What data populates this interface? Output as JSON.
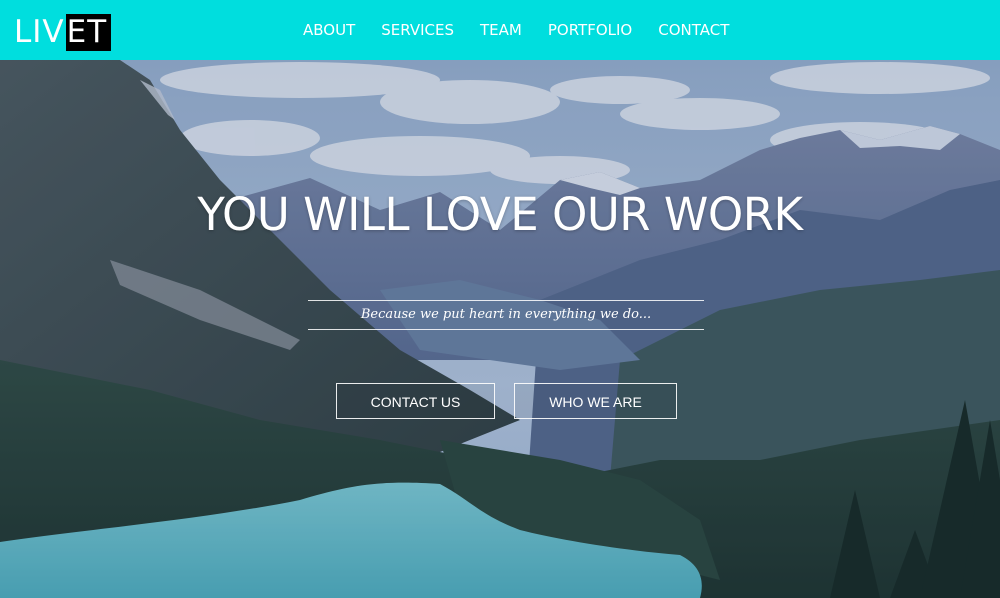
{
  "header": {
    "logo": {
      "part_a": "LIV",
      "part_b": "ET"
    },
    "nav": [
      {
        "label": "ABOUT"
      },
      {
        "label": "SERVICES"
      },
      {
        "label": "TEAM"
      },
      {
        "label": "PORTFOLIO"
      },
      {
        "label": "CONTACT"
      }
    ],
    "background_color": "#00dede"
  },
  "hero": {
    "headline": "YOU WILL LOVE OUR WORK",
    "tagline": "Because we put heart in everything we do...",
    "buttons": {
      "contact_label": "CONTACT US",
      "who_label": "WHO WE ARE"
    }
  }
}
